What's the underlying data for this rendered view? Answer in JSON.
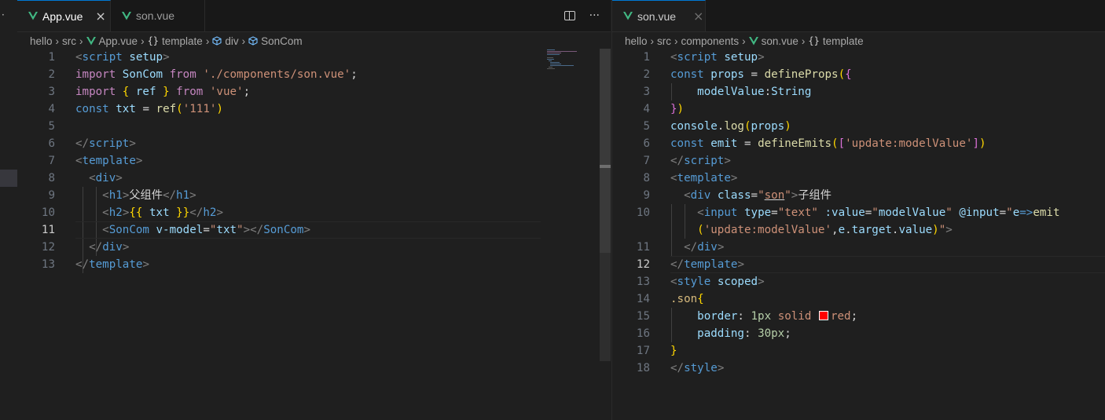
{
  "left_pane": {
    "tabs": [
      {
        "label": "App.vue",
        "active": true,
        "icon": "vue-icon",
        "close": "×"
      },
      {
        "label": "son.vue",
        "active": false,
        "icon": "vue-icon"
      }
    ],
    "actions": {
      "split": "split-editor-icon",
      "more": "···"
    },
    "breadcrumb": [
      "hello",
      "src",
      "App.vue",
      "template",
      "div",
      "SonCom"
    ],
    "current_line": 11
  },
  "right_pane": {
    "tabs": [
      {
        "label": "son.vue",
        "active": true,
        "icon": "vue-icon",
        "close": "×"
      }
    ],
    "breadcrumb": [
      "hello",
      "src",
      "components",
      "son.vue",
      "template"
    ],
    "current_line": 12
  },
  "colors": {
    "background": "#1f1f1f",
    "tab_bar": "#181818",
    "vue_green": "#41b883",
    "keyword": "#c586c0",
    "tag": "#569cd6",
    "attribute": "#9cdcfe",
    "string": "#ce9178",
    "function": "#dcdcaa"
  }
}
